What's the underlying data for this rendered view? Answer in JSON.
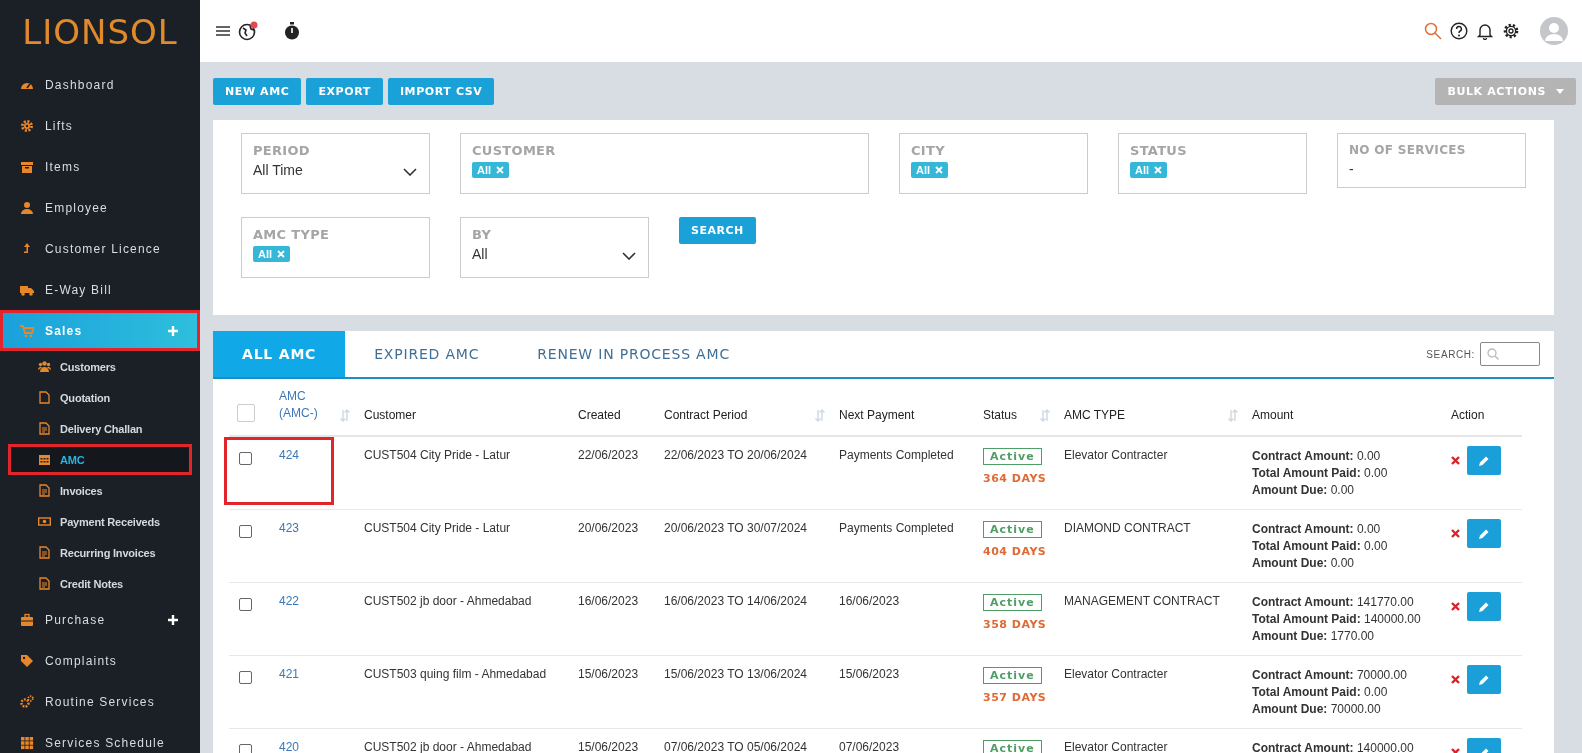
{
  "sidebar": {
    "logo": "LIONSOL",
    "items": [
      {
        "label": "Dashboard",
        "selected": false,
        "highlighted": false,
        "expandable": false
      },
      {
        "label": "Lifts",
        "selected": false,
        "highlighted": false,
        "expandable": false
      },
      {
        "label": "Items",
        "selected": false,
        "highlighted": false,
        "expandable": false
      },
      {
        "label": "Employee",
        "selected": false,
        "highlighted": false,
        "expandable": false
      },
      {
        "label": "Customer Licence",
        "selected": false,
        "highlighted": false,
        "expandable": false
      },
      {
        "label": "E-Way Bill",
        "selected": false,
        "highlighted": false,
        "expandable": false
      },
      {
        "label": "Sales",
        "selected": true,
        "highlighted": true,
        "expandable": true,
        "children": [
          {
            "label": "Customers",
            "selected": false,
            "highlighted": false
          },
          {
            "label": "Quotation",
            "selected": false,
            "highlighted": false
          },
          {
            "label": "Delivery Challan",
            "selected": false,
            "highlighted": false
          },
          {
            "label": "AMC",
            "selected": true,
            "highlighted": true
          },
          {
            "label": "Invoices",
            "selected": false,
            "highlighted": false
          },
          {
            "label": "Payment Receiveds",
            "selected": false,
            "highlighted": false
          },
          {
            "label": "Recurring Invoices",
            "selected": false,
            "highlighted": false
          },
          {
            "label": "Credit Notes",
            "selected": false,
            "highlighted": false
          }
        ]
      },
      {
        "label": "Purchase",
        "selected": false,
        "highlighted": false,
        "expandable": true
      },
      {
        "label": "Complaints",
        "selected": false,
        "highlighted": false,
        "expandable": false
      },
      {
        "label": "Routine Services",
        "selected": false,
        "highlighted": false,
        "expandable": false
      },
      {
        "label": "Services Schedule",
        "selected": false,
        "highlighted": false,
        "expandable": false
      }
    ]
  },
  "toolbar": {
    "buttons": [
      "NEW AMC",
      "EXPORT",
      "IMPORT CSV"
    ],
    "bulk_actions": "BULK ACTIONS"
  },
  "filters": {
    "rows": [
      [
        {
          "kind": "select",
          "label": "PERIOD",
          "value": "All Time"
        },
        {
          "kind": "tags",
          "label": "CUSTOMER",
          "tags": [
            "All"
          ]
        },
        {
          "kind": "tags",
          "label": "CITY",
          "tags": [
            "All"
          ]
        },
        {
          "kind": "tags",
          "label": "STATUS",
          "tags": [
            "All"
          ]
        },
        {
          "kind": "text",
          "label": "NO OF SERVICES",
          "value": "-"
        }
      ],
      [
        {
          "kind": "tags",
          "label": "AMC TYPE",
          "tags": [
            "All"
          ]
        },
        {
          "kind": "select",
          "label": "BY",
          "value": "All"
        }
      ]
    ],
    "search_button": "SEARCH"
  },
  "tabs": [
    {
      "label": "ALL AMC",
      "selected": true
    },
    {
      "label": "EXPIRED AMC",
      "selected": false
    },
    {
      "label": "RENEW IN PROCESS AMC",
      "selected": false
    }
  ],
  "table_search": {
    "label": "SEARCH:"
  },
  "table": {
    "select_all": {
      "checked": false
    },
    "columns": [
      {
        "label": "AMC (AMC-)",
        "sortable": true
      },
      {
        "label": "Customer",
        "sortable": false
      },
      {
        "label": "Created",
        "sortable": false
      },
      {
        "label": "Contract Period",
        "sortable": true
      },
      {
        "label": "Next Payment",
        "sortable": false
      },
      {
        "label": "Status",
        "sortable": true
      },
      {
        "label": "AMC TYPE",
        "sortable": true
      },
      {
        "label": "Amount",
        "sortable": false
      },
      {
        "label": "Action",
        "sortable": false
      }
    ],
    "rows": [
      {
        "checked": false,
        "highlighted": true,
        "amc": "424",
        "customer": "CUST504 City Pride - Latur",
        "created": "22/06/2023",
        "period": "22/06/2023 TO 20/06/2024",
        "next_payment": "Payments Completed",
        "status": "Active",
        "days": "364 DAYS",
        "amc_type": "Elevator Contracter",
        "amounts": [
          "**Contract Amount:** 0.00",
          "**Total Amount Paid:** 0.00",
          "**Amount Due:** 0.00"
        ]
      },
      {
        "checked": false,
        "highlighted": false,
        "amc": "423",
        "customer": "CUST504 City Pride - Latur",
        "created": "20/06/2023",
        "period": "20/06/2023 TO 30/07/2024",
        "next_payment": "Payments Completed",
        "status": "Active",
        "days": "404 DAYS",
        "amc_type": "DIAMOND CONTRACT",
        "amounts": [
          "**Contract Amount:** 0.00",
          "**Total Amount Paid:** 0.00",
          "**Amount Due:** 0.00"
        ]
      },
      {
        "checked": false,
        "highlighted": false,
        "amc": "422",
        "customer": "CUST502 jb door - Ahmedabad",
        "created": "16/06/2023",
        "period": "16/06/2023 TO 14/06/2024",
        "next_payment": "16/06/2023",
        "status": "Active",
        "days": "358 DAYS",
        "amc_type": "MANAGEMENT CONTRACT",
        "amounts": [
          "**Contract Amount:** 141770.00",
          "**Total Amount Paid:** 140000.00",
          "**Amount Due:** 1770.00"
        ]
      },
      {
        "checked": false,
        "highlighted": false,
        "amc": "421",
        "customer": "CUST503 quing film - Ahmedabad",
        "created": "15/06/2023",
        "period": "15/06/2023 TO 13/06/2024",
        "next_payment": "15/06/2023",
        "status": "Active",
        "days": "357 DAYS",
        "amc_type": "Elevator Contracter",
        "amounts": [
          "**Contract Amount:** 70000.00",
          "**Total Amount Paid:** 0.00",
          "**Amount Due:** 70000.00"
        ]
      },
      {
        "checked": false,
        "highlighted": false,
        "amc": "420",
        "customer": "CUST502 jb door - Ahmedabad",
        "created": "15/06/2023",
        "period": "07/06/2023 TO 05/06/2024",
        "next_payment": "07/06/2023",
        "status": "Active",
        "amc_type": "Elevator Contracter",
        "amounts": [
          "**Contract Amount:** 140000.00"
        ]
      }
    ]
  }
}
